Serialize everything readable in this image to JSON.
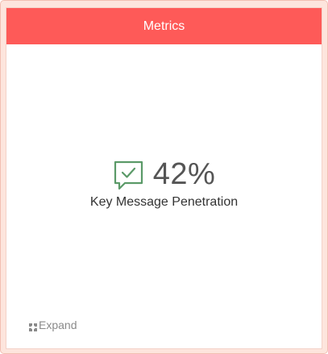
{
  "widget": {
    "title": "Metrics",
    "metric_value": "42%",
    "metric_label": "Key Message Penetration",
    "metric_icon": "chat-check-icon",
    "expand_label": "Expand",
    "expand_icon": "expand-icon"
  },
  "colors": {
    "header_bg": "#fe5a58",
    "icon_green": "#5b9a68",
    "frame_bg": "#fde5dd"
  }
}
